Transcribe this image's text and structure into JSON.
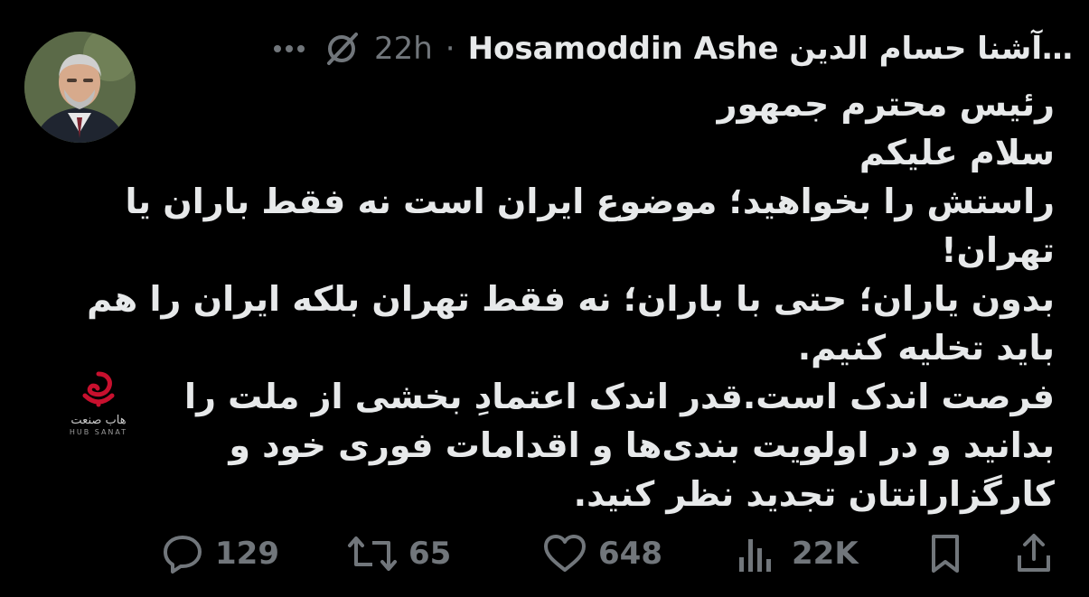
{
  "tweet": {
    "author_name": "Hosamoddin Ashe آشنا حسام الدين…",
    "separator": "·",
    "time": "22h",
    "lines": [
      "رئیس محترم جمهور",
      "سلام علیکم",
      "راستش را بخواهید؛ موضوع ایران است نه فقط باران یا",
      "تهران!",
      "بدون یاران؛ حتی با باران؛ نه فقط تهران بلکه ایران را هم",
      "باید تخلیه کنیم.",
      "فرصت اندک است.قدر اندک اعتمادِ بخشی از ملت را",
      "بدانید و در اولویت بندی‌ها و اقدامات فوری خود و",
      "کارگزارانتان تجدید نظر کنید."
    ]
  },
  "watermark": {
    "fa": "هاب صنعت",
    "en": "HUB SANAT"
  },
  "actions": {
    "replies": "129",
    "reposts": "65",
    "likes": "648",
    "views": "22K"
  },
  "icons": {
    "header_right": [
      "more-icon",
      "grok-icon"
    ],
    "actions": [
      "reply-icon",
      "repost-icon",
      "like-icon",
      "views-icon",
      "bookmark-icon",
      "share-icon"
    ]
  },
  "colors": {
    "background": "#000000",
    "text": "#e7e9ea",
    "secondary": "#71767b",
    "watermark_red": "#c8102e"
  }
}
